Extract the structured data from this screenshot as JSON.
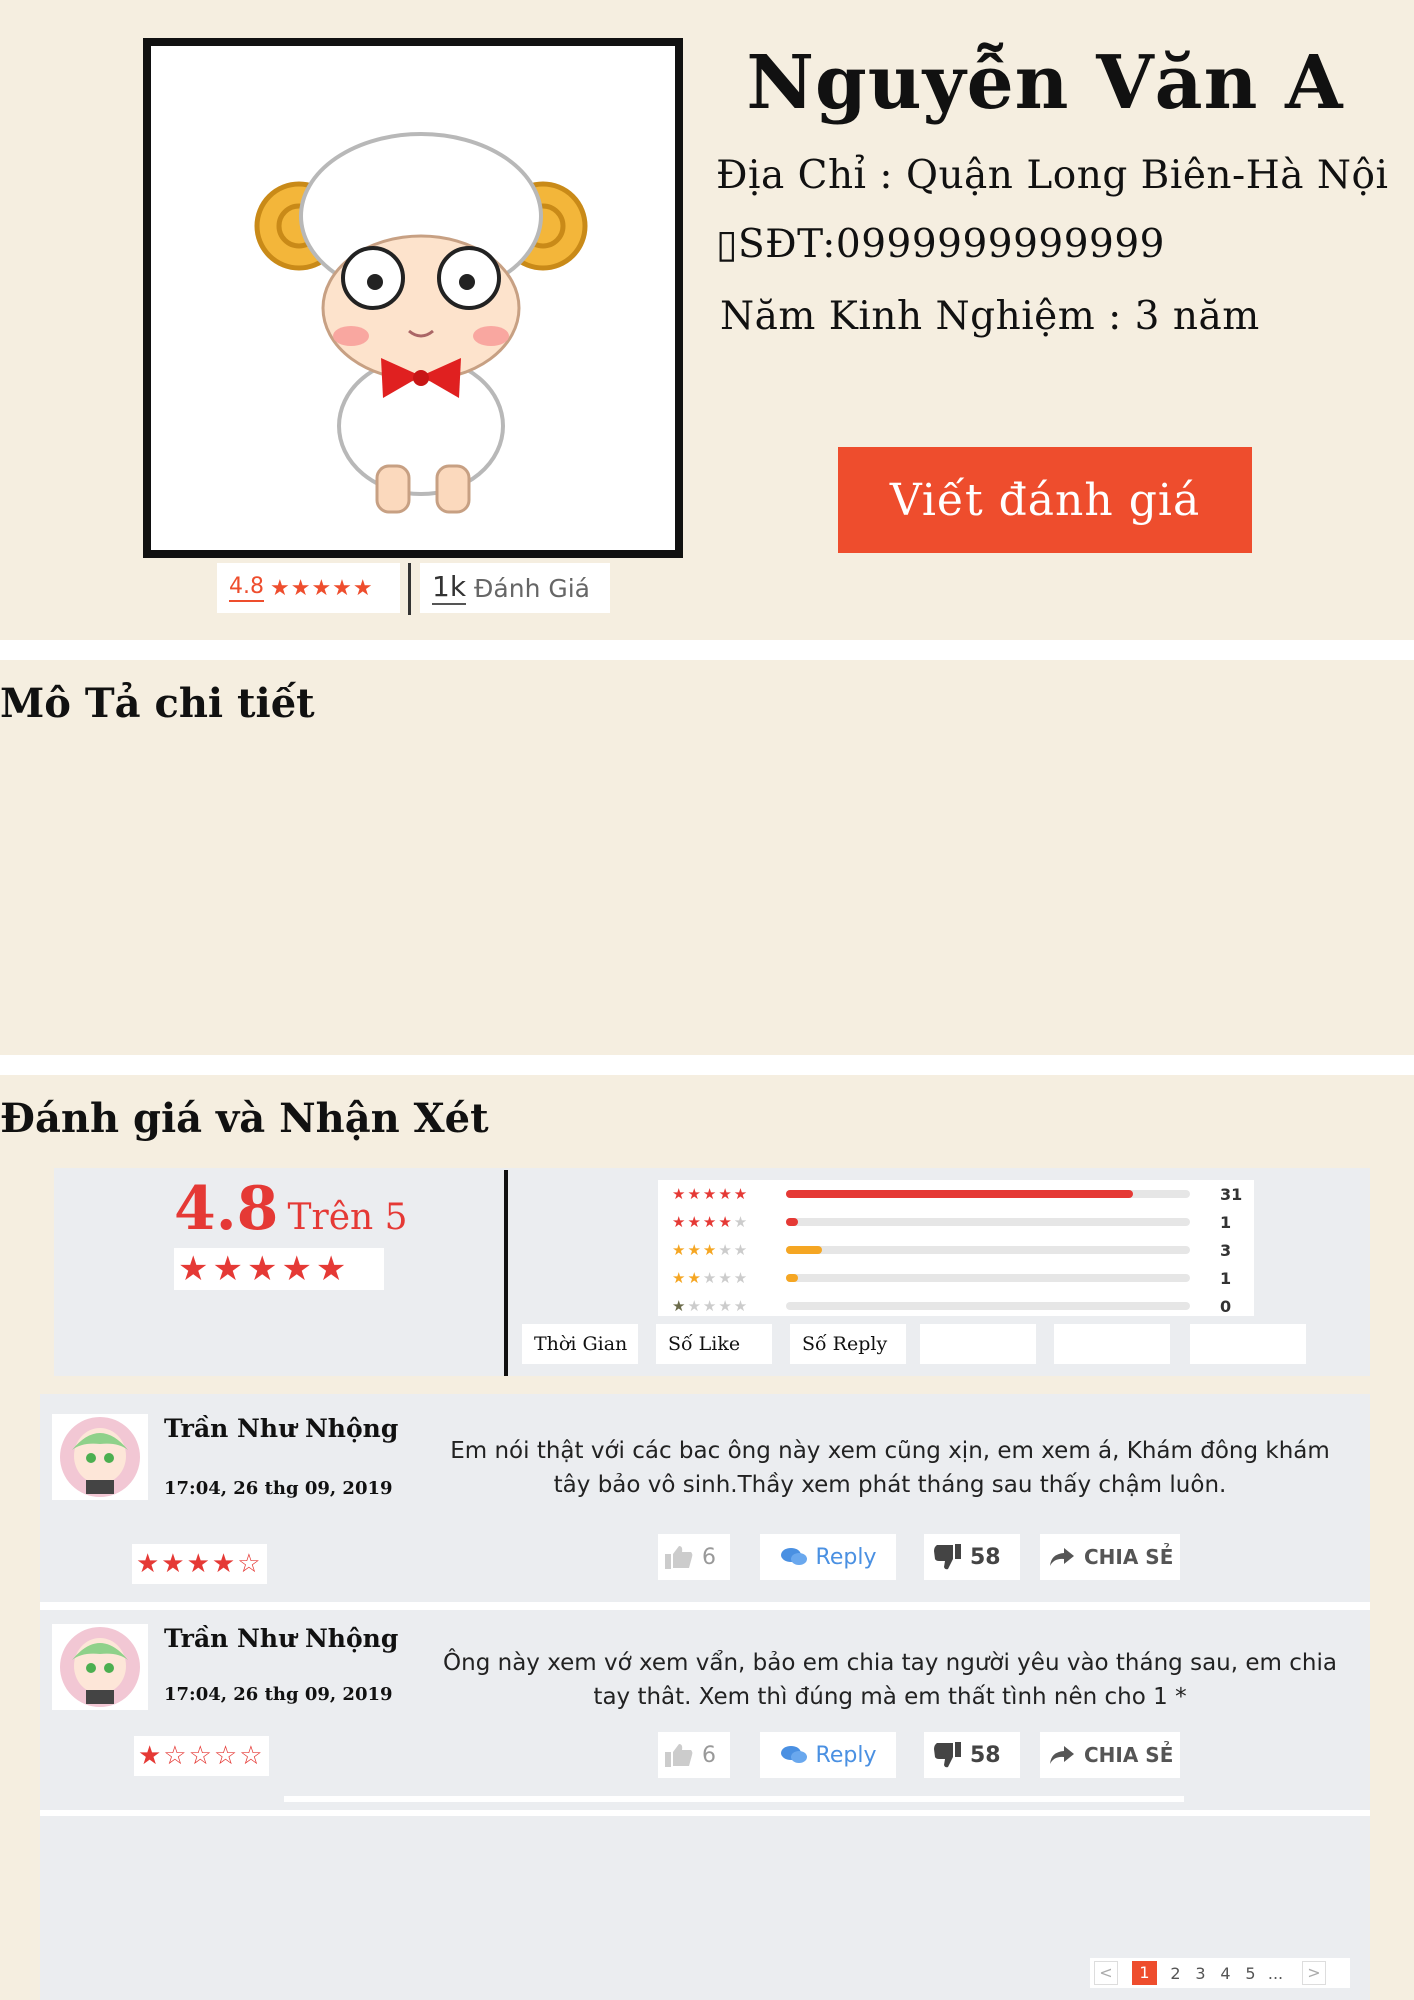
{
  "profile": {
    "name": "Nguyễn Văn A",
    "address": "Địa Chỉ : Quận Long Biên-Hà Nội",
    "phone": "SĐT:0999999999999",
    "experience": "Năm Kinh Nghiệm : 3 năm",
    "write_review_label": "Viết đánh giá",
    "rating_value": "4.8",
    "rating_stars": "★★★★★",
    "review_count": "1k",
    "review_count_label": "Đánh Giá"
  },
  "sections": {
    "description_title": "Mô Tả chi tiết",
    "reviews_title": "Đánh giá và Nhận Xét"
  },
  "summary": {
    "score": "4.8",
    "out_of": "Trên 5",
    "stars": "★★★★★",
    "rating_fraction": 0.96,
    "bars": [
      {
        "stars": 5,
        "count": "31",
        "fill": 0.86,
        "color": "#e53935"
      },
      {
        "stars": 4,
        "count": "1",
        "fill": 0.03,
        "color": "#e53935"
      },
      {
        "stars": 3,
        "count": "3",
        "fill": 0.09,
        "color": "#f5a623"
      },
      {
        "stars": 2,
        "count": "1",
        "fill": 0.03,
        "color": "#f5a623"
      },
      {
        "stars": 1,
        "count": "0",
        "fill": 0,
        "color": "#e53935"
      }
    ],
    "filters": [
      "Thời Gian",
      "Số Like",
      "Số Reply",
      "",
      "",
      ""
    ]
  },
  "comments": [
    {
      "author": "Trần Như Nhộng",
      "date": "17:04, 26 thg 09, 2019",
      "stars": "★★★★☆",
      "text": "Em nói thật với các bac ông này xem cũng xịn, em xem á, Khám đông khám tây bảo vô sinh.Thầy xem phát tháng sau thấy chậm luôn.",
      "likes": "6",
      "reply_label": "Reply",
      "dislikes": "58",
      "share_label": "CHIA SẺ"
    },
    {
      "author": "Trần Như Nhộng",
      "date": "17:04, 26 thg 09, 2019",
      "stars": "★☆☆☆☆",
      "text": "Ông này xem vớ xem vẩn, bảo em chia tay người yêu vào tháng sau, em chia tay thât. Xem thì đúng mà em thất tình nên cho 1 *",
      "likes": "6",
      "reply_label": "Reply",
      "dislikes": "58",
      "share_label": "CHIA SẺ"
    }
  ],
  "pagination": {
    "prev": "<",
    "pages": [
      "1",
      "2",
      "3",
      "4",
      "5",
      "..."
    ],
    "next": ">"
  },
  "colors": {
    "background": "#f5eee0",
    "accent": "#ee4d2d",
    "panel": "#ebedf0"
  },
  "icons": [
    "sheep-avatar-image",
    "anime-avatar-image",
    "thumbs-up-icon",
    "chat-bubbles-icon",
    "thumbs-down-icon",
    "share-arrow-icon",
    "phone-glyph-icon"
  ]
}
